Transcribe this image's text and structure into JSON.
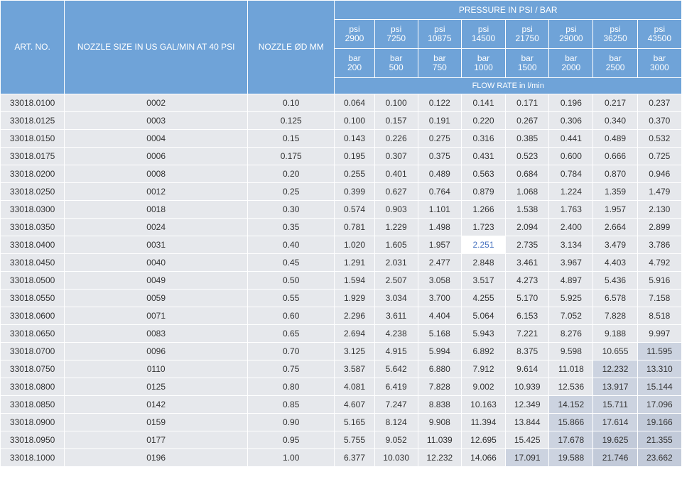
{
  "header": {
    "art_no": "ART. NO.",
    "nozzle_size": "NOZZLE SIZE IN US GAL/MIN AT 40 PSI",
    "nozzle_d": "NOZZLE ØD MM",
    "pressure": "PRESSURE IN PSI / BAR",
    "flow_rate": "FLOW RATE in l/min",
    "psi_label": "psi",
    "bar_label": "bar",
    "psi_values": [
      "2900",
      "7250",
      "10875",
      "14500",
      "21750",
      "29000",
      "36250",
      "43500"
    ],
    "bar_values": [
      "200",
      "500",
      "750",
      "1000",
      "1500",
      "2000",
      "2500",
      "3000"
    ]
  },
  "highlight_colors": {
    "selected_cell": "#ffffff",
    "shade_light": "#ccd3e0",
    "shade_dark": "#c2cad9"
  },
  "rows": [
    {
      "art": "33018.0100",
      "size": "0002",
      "d": "0.10",
      "f": [
        "0.064",
        "0.100",
        "0.122",
        "0.141",
        "0.171",
        "0.196",
        "0.217",
        "0.237"
      ]
    },
    {
      "art": "33018.0125",
      "size": "0003",
      "d": "0.125",
      "f": [
        "0.100",
        "0.157",
        "0.191",
        "0.220",
        "0.267",
        "0.306",
        "0.340",
        "0.370"
      ]
    },
    {
      "art": "33018.0150",
      "size": "0004",
      "d": "0.15",
      "f": [
        "0.143",
        "0.226",
        "0.275",
        "0.316",
        "0.385",
        "0.441",
        "0.489",
        "0.532"
      ]
    },
    {
      "art": "33018.0175",
      "size": "0006",
      "d": "0.175",
      "f": [
        "0.195",
        "0.307",
        "0.375",
        "0.431",
        "0.523",
        "0.600",
        "0.666",
        "0.725"
      ]
    },
    {
      "art": "33018.0200",
      "size": "0008",
      "d": "0.20",
      "f": [
        "0.255",
        "0.401",
        "0.489",
        "0.563",
        "0.684",
        "0.784",
        "0.870",
        "0.946"
      ]
    },
    {
      "art": "33018.0250",
      "size": "0012",
      "d": "0.25",
      "f": [
        "0.399",
        "0.627",
        "0.764",
        "0.879",
        "1.068",
        "1.224",
        "1.359",
        "1.479"
      ]
    },
    {
      "art": "33018.0300",
      "size": "0018",
      "d": "0.30",
      "f": [
        "0.574",
        "0.903",
        "1.101",
        "1.266",
        "1.538",
        "1.763",
        "1.957",
        "2.130"
      ]
    },
    {
      "art": "33018.0350",
      "size": "0024",
      "d": "0.35",
      "f": [
        "0.781",
        "1.229",
        "1.498",
        "1.723",
        "2.094",
        "2.400",
        "2.664",
        "2.899"
      ]
    },
    {
      "art": "33018.0400",
      "size": "0031",
      "d": "0.40",
      "f": [
        "1.020",
        "1.605",
        "1.957",
        "2.251",
        "2.735",
        "3.134",
        "3.479",
        "3.786"
      ]
    },
    {
      "art": "33018.0450",
      "size": "0040",
      "d": "0.45",
      "f": [
        "1.291",
        "2.031",
        "2.477",
        "2.848",
        "3.461",
        "3.967",
        "4.403",
        "4.792"
      ]
    },
    {
      "art": "33018.0500",
      "size": "0049",
      "d": "0.50",
      "f": [
        "1.594",
        "2.507",
        "3.058",
        "3.517",
        "4.273",
        "4.897",
        "5.436",
        "5.916"
      ]
    },
    {
      "art": "33018.0550",
      "size": "0059",
      "d": "0.55",
      "f": [
        "1.929",
        "3.034",
        "3.700",
        "4.255",
        "5.170",
        "5.925",
        "6.578",
        "7.158"
      ]
    },
    {
      "art": "33018.0600",
      "size": "0071",
      "d": "0.60",
      "f": [
        "2.296",
        "3.611",
        "4.404",
        "5.064",
        "6.153",
        "7.052",
        "7.828",
        "8.518"
      ]
    },
    {
      "art": "33018.0650",
      "size": "0083",
      "d": "0.65",
      "f": [
        "2.694",
        "4.238",
        "5.168",
        "5.943",
        "7.221",
        "8.276",
        "9.188",
        "9.997"
      ]
    },
    {
      "art": "33018.0700",
      "size": "0096",
      "d": "0.70",
      "f": [
        "3.125",
        "4.915",
        "5.994",
        "6.892",
        "8.375",
        "9.598",
        "10.655",
        "11.595"
      ]
    },
    {
      "art": "33018.0750",
      "size": "0110",
      "d": "0.75",
      "f": [
        "3.587",
        "5.642",
        "6.880",
        "7.912",
        "9.614",
        "11.018",
        "12.232",
        "13.310"
      ]
    },
    {
      "art": "33018.0800",
      "size": "0125",
      "d": "0.80",
      "f": [
        "4.081",
        "6.419",
        "7.828",
        "9.002",
        "10.939",
        "12.536",
        "13.917",
        "15.144"
      ]
    },
    {
      "art": "33018.0850",
      "size": "0142",
      "d": "0.85",
      "f": [
        "4.607",
        "7.247",
        "8.838",
        "10.163",
        "12.349",
        "14.152",
        "15.711",
        "17.096"
      ]
    },
    {
      "art": "33018.0900",
      "size": "0159",
      "d": "0.90",
      "f": [
        "5.165",
        "8.124",
        "9.908",
        "11.394",
        "13.844",
        "15.866",
        "17.614",
        "19.166"
      ]
    },
    {
      "art": "33018.0950",
      "size": "0177",
      "d": "0.95",
      "f": [
        "5.755",
        "9.052",
        "11.039",
        "12.695",
        "15.425",
        "17.678",
        "19.625",
        "21.355"
      ]
    },
    {
      "art": "33018.1000",
      "size": "0196",
      "d": "1.00",
      "f": [
        "6.377",
        "10.030",
        "12.232",
        "14.066",
        "17.091",
        "19.588",
        "21.746",
        "23.662"
      ]
    }
  ]
}
